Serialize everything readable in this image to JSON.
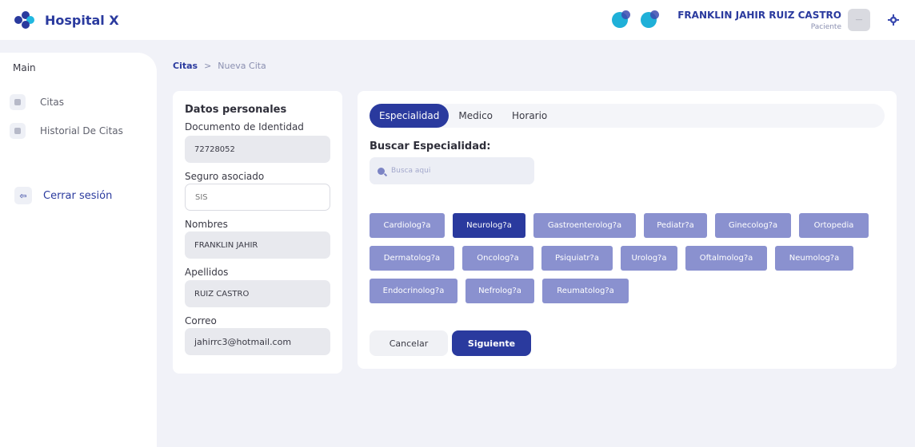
{
  "app": {
    "brand": "Hospital X"
  },
  "user": {
    "name": "FRANKLIN JAHIR RUIZ CASTRO",
    "role": "Paciente"
  },
  "sidebar": {
    "section": "Main",
    "items": [
      {
        "label": "Citas",
        "icon": "calendar-icon"
      },
      {
        "label": "Historial De Citas",
        "icon": "history-icon"
      }
    ],
    "logout": "Cerrar sesión"
  },
  "breadcrumb": {
    "parent": "Citas",
    "separator": ">",
    "current": "Nueva Cita"
  },
  "personal": {
    "title": "Datos personales",
    "doc_label": "Documento de Identidad",
    "doc_value": "72728052",
    "insurance_label": "Seguro asociado",
    "insurance_value": "SIS",
    "names_label": "Nombres",
    "names_value": "FRANKLIN JAHIR",
    "surnames_label": "Apellidos",
    "surnames_value": "RUIZ CASTRO",
    "email_label": "Correo",
    "email_value": "jahirrc3@hotmail.com"
  },
  "tabs": [
    {
      "label": "Especialidad",
      "active": true
    },
    {
      "label": "Medico",
      "active": false
    },
    {
      "label": "Horario",
      "active": false
    }
  ],
  "search": {
    "title": "Buscar Especialidad:",
    "placeholder": "Busca aqui"
  },
  "specialties": [
    {
      "label": "Cardiolog?a",
      "active": false
    },
    {
      "label": "Neurolog?a",
      "active": true
    },
    {
      "label": "Gastroenterolog?a",
      "active": false
    },
    {
      "label": "Pediatr?a",
      "active": false
    },
    {
      "label": "Ginecolog?a",
      "active": false
    },
    {
      "label": "Ortopedia",
      "active": false
    },
    {
      "label": "Dermatolog?a",
      "active": false
    },
    {
      "label": "Oncolog?a",
      "active": false
    },
    {
      "label": "Psiquiatr?a",
      "active": false
    },
    {
      "label": "Urolog?a",
      "active": false
    },
    {
      "label": "Oftalmolog?a",
      "active": false
    },
    {
      "label": "Neumolog?a",
      "active": false
    },
    {
      "label": "Endocrinolog?a",
      "active": false
    },
    {
      "label": "Nefrolog?a",
      "active": false
    },
    {
      "label": "Reumatolog?a",
      "active": false
    }
  ],
  "actions": {
    "cancel": "Cancelar",
    "next": "Siguiente"
  },
  "colors": {
    "primary": "#2a3a9e",
    "chip": "#8a91cf",
    "accent": "#22b8e0",
    "background": "#f1f2f8"
  }
}
